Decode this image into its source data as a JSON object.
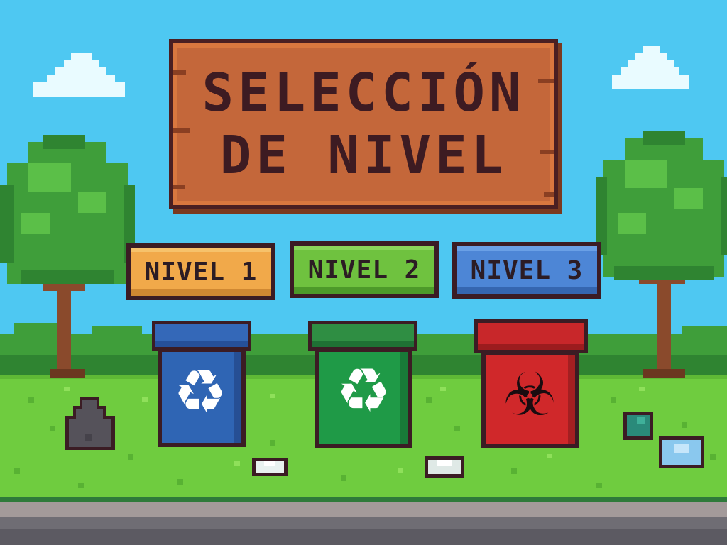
{
  "title": {
    "line1": "SELECCIÓN",
    "line2": "DE NIVEL"
  },
  "levels": [
    {
      "label": "NIVEL 1",
      "color": "#f1a94a"
    },
    {
      "label": "NIVEL 2",
      "color": "#6fc23f"
    },
    {
      "label": "NIVEL 3",
      "color": "#4d86d6"
    }
  ],
  "bins": [
    {
      "color": "#2f65b4",
      "icon": "recycle-icon",
      "glyph": "♻"
    },
    {
      "color": "#1f9a47",
      "icon": "recycle-icon",
      "glyph": "♻"
    },
    {
      "color": "#d0282a",
      "icon": "biohazard-icon",
      "glyph": "☣"
    }
  ],
  "colors": {
    "sky": "#4ec8f2",
    "grass": "#6fcc3f",
    "sign_wood": "#c4673a",
    "outline": "#3b1c24"
  }
}
